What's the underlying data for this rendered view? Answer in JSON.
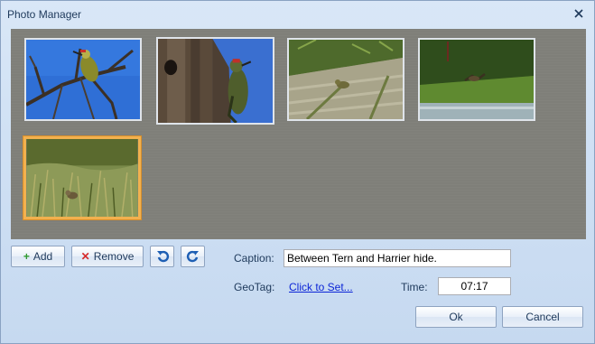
{
  "window": {
    "title": "Photo Manager"
  },
  "photos": [
    {
      "name": "thumb-woodpecker-branch",
      "selected": false
    },
    {
      "name": "thumb-woodpecker-trunk",
      "selected": false
    },
    {
      "name": "thumb-bird-grass-slope",
      "selected": false
    },
    {
      "name": "thumb-bird-over-water",
      "selected": false
    },
    {
      "name": "thumb-bird-in-grass",
      "selected": true
    }
  ],
  "toolbar": {
    "add_label": "Add",
    "remove_label": "Remove",
    "rotate_left_icon": "rotate-left-icon",
    "rotate_right_icon": "rotate-right-icon"
  },
  "caption": {
    "label": "Caption:",
    "value": "Between Tern and Harrier hide."
  },
  "geotag": {
    "label": "GeoTag:",
    "link": "Click to Set..."
  },
  "time": {
    "label": "Time:",
    "value": "07:17"
  },
  "buttons": {
    "ok": "Ok",
    "cancel": "Cancel"
  },
  "colors": {
    "selection": "#f2b14f",
    "link": "#0b24d6",
    "gallery_bg": "#7f7f79"
  }
}
